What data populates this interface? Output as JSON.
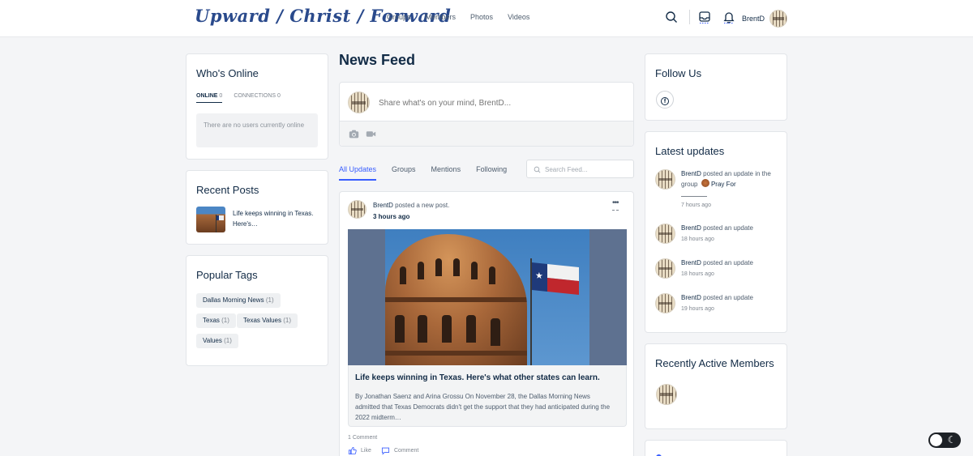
{
  "header": {
    "logo_text": "Upward / Christ / Forward",
    "nav": [
      "Groups",
      "Members",
      "Photos",
      "Videos"
    ],
    "user_name": "BrentD"
  },
  "whos_online": {
    "title": "Who's Online",
    "tab_online_label": "ONLINE",
    "tab_online_count": "0",
    "tab_connections_label": "CONNECTIONS",
    "tab_connections_count": "0",
    "empty_text": "There are no users currently online"
  },
  "recent_posts": {
    "title": "Recent Posts",
    "items": [
      {
        "title": "Life keeps winning in Texas. Here's…"
      }
    ]
  },
  "popular_tags": {
    "title": "Popular Tags",
    "tags": [
      {
        "name": "Dallas Morning News",
        "count": "(1)"
      },
      {
        "name": "Texas",
        "count": "(1)"
      },
      {
        "name": "Texas Values",
        "count": "(1)"
      },
      {
        "name": "Values",
        "count": "(1)"
      }
    ]
  },
  "news_feed": {
    "title": "News Feed",
    "composer_placeholder": "Share what's on your mind, BrentD...",
    "tabs": [
      "All Updates",
      "Groups",
      "Mentions",
      "Following"
    ],
    "search_placeholder": "Search Feed...",
    "post": {
      "author": "BrentD",
      "action": "posted a new post.",
      "time": "3 hours ago",
      "more_label": "•••",
      "link_title": "Life keeps winning in Texas. Here's what other states can learn.",
      "link_desc": "By Jonathan Saenz and Arina Grossu On November 28, the Dallas Morning News admitted that Texas Democrats didn't get the support that they had anticipated during the 2022 midterm…",
      "comments_count": "1 Comment",
      "like_label": "Like",
      "comment_label": "Comment"
    }
  },
  "follow_us": {
    "title": "Follow Us",
    "fb_letter": "f"
  },
  "latest_updates": {
    "title": "Latest updates",
    "items": [
      {
        "author": "BrentD",
        "text": "posted an update in the group",
        "group": "Pray For",
        "time": "7 hours ago"
      },
      {
        "author": "BrentD",
        "text": "posted an update",
        "time": "18 hours ago"
      },
      {
        "author": "BrentD",
        "text": "posted an update",
        "time": "18 hours ago"
      },
      {
        "author": "BrentD",
        "text": "posted an update",
        "time": "19 hours ago"
      }
    ]
  },
  "recently_active": {
    "title": "Recently Active Members"
  },
  "colors": {
    "accent": "#385dff",
    "text": "#122b46",
    "muted": "#7f868f"
  }
}
